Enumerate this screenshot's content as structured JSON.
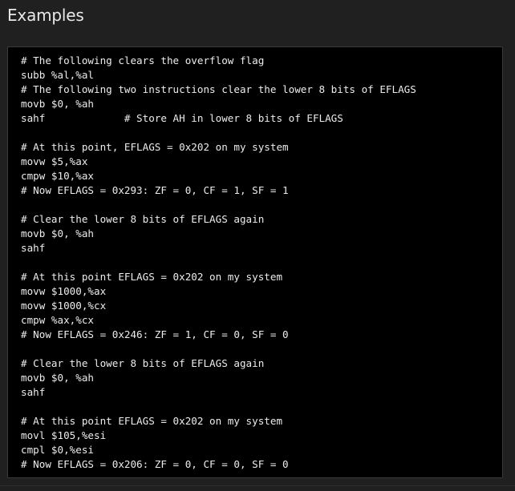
{
  "section": {
    "title": "Examples"
  },
  "code": {
    "lines": [
      "# The following clears the overflow flag",
      "subb %al,%al",
      "# The following two instructions clear the lower 8 bits of EFLAGS",
      "movb $0, %ah",
      "sahf             # Store AH in lower 8 bits of EFLAGS",
      "",
      "# At this point, EFLAGS = 0x202 on my system",
      "movw $5,%ax",
      "cmpw $10,%ax",
      "# Now EFLAGS = 0x293: ZF = 0, CF = 1, SF = 1",
      "",
      "# Clear the lower 8 bits of EFLAGS again",
      "movb $0, %ah",
      "sahf",
      "",
      "# At this point EFLAGS = 0x202 on my system",
      "movw $1000,%ax",
      "movw $1000,%cx",
      "cmpw %ax,%cx",
      "# Now EFLAGS = 0x246: ZF = 1, CF = 0, SF = 0",
      "",
      "# Clear the lower 8 bits of EFLAGS again",
      "movb $0, %ah",
      "sahf",
      "",
      "# At this point EFLAGS = 0x202 on my system",
      "movl $105,%esi",
      "cmpl $0,%esi",
      "# Now EFLAGS = 0x206: ZF = 0, CF = 0, SF = 0"
    ]
  }
}
